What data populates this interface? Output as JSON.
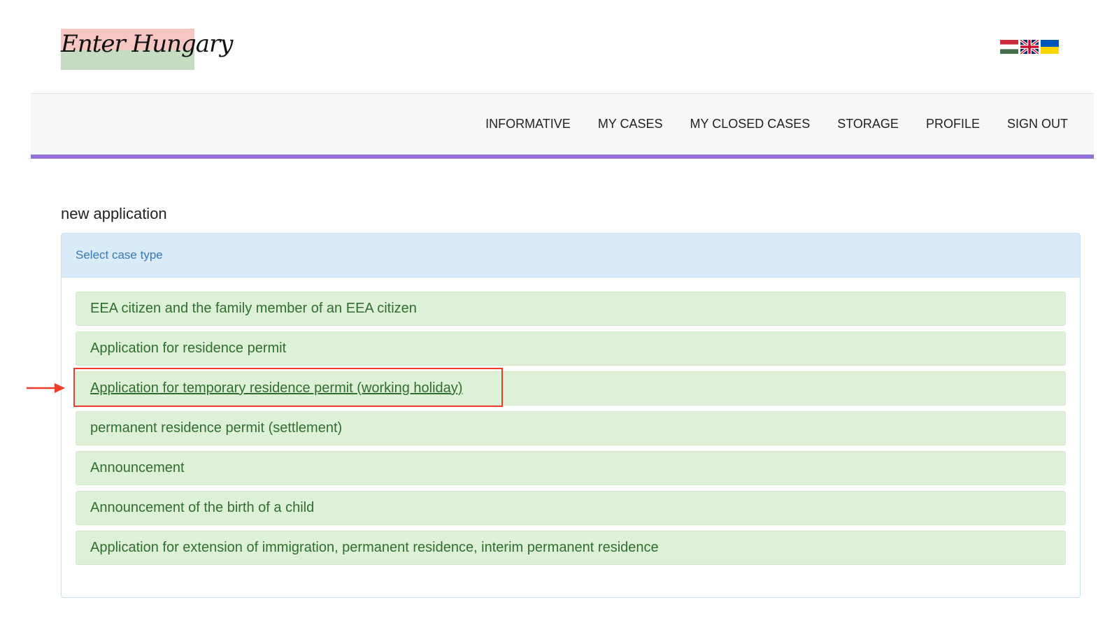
{
  "header": {
    "logo_text": "Enter Hungary",
    "languages": [
      {
        "name": "hungarian-flag-icon"
      },
      {
        "name": "uk-flag-icon"
      },
      {
        "name": "ukrainian-flag-icon"
      }
    ]
  },
  "nav": {
    "items": [
      "INFORMATIVE",
      "MY CASES",
      "MY CLOSED CASES",
      "STORAGE",
      "PROFILE",
      "SIGN OUT"
    ]
  },
  "main": {
    "heading": "new application",
    "panel_title": "Select case type",
    "case_types": [
      "EEA citizen and the family member of an EEA citizen",
      "Application for residence permit",
      "Application for temporary residence permit (working holiday)",
      "permanent residence permit (settlement)",
      "Announcement",
      "Announcement of the birth of a child",
      "Application for extension of immigration, permanent residence, interim permanent residence"
    ],
    "highlighted_index": 2
  },
  "colors": {
    "nav_accent": "#9370db",
    "panel_heading_bg": "#d9ebf6",
    "item_bg": "#dff0d8",
    "item_text": "#2f6e2f",
    "annotation": "#ee3b2a"
  },
  "annotation_icons": [
    "red-arrow-icon"
  ]
}
